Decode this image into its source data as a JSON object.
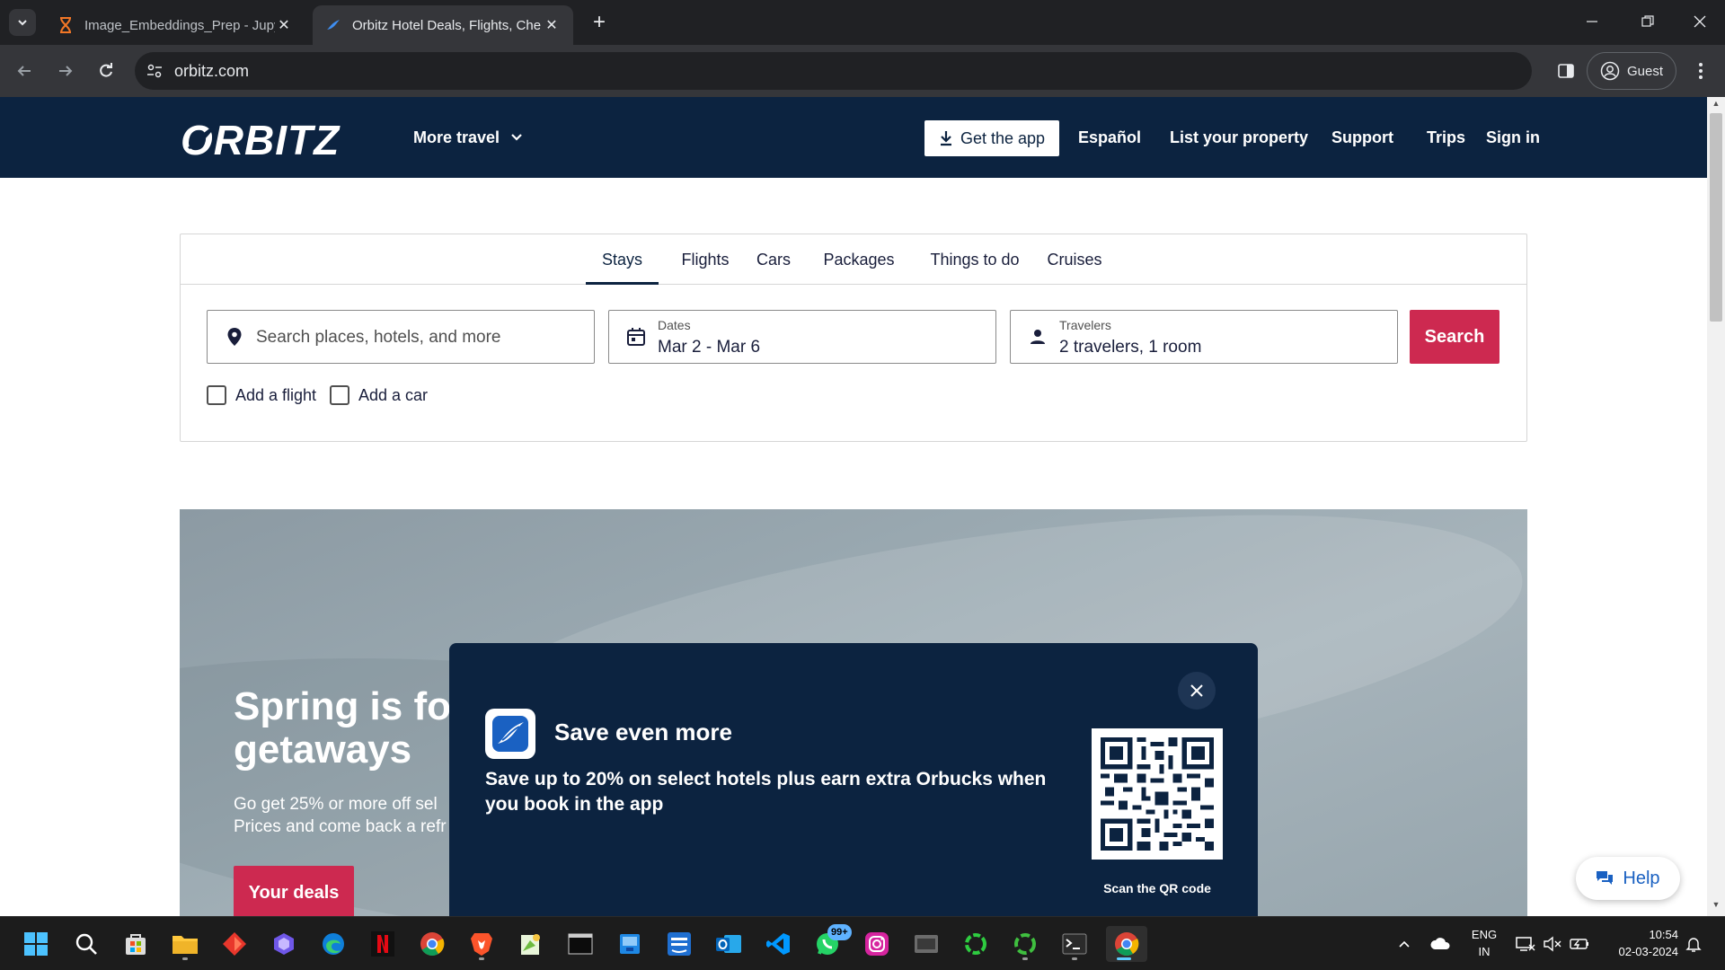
{
  "browser": {
    "tabs": [
      {
        "title": "Image_Embeddings_Prep - Jupy",
        "active": false
      },
      {
        "title": "Orbitz Hotel Deals, Flights, Che",
        "active": true
      }
    ],
    "address": "orbitz.com",
    "profile_label": "Guest"
  },
  "header": {
    "logo_text": "ORBITZ",
    "more_travel": "More travel",
    "get_app": "Get the app",
    "nav": [
      "Español",
      "List your property",
      "Support",
      "Trips",
      "Sign in"
    ]
  },
  "search": {
    "tabs": [
      "Stays",
      "Flights",
      "Cars",
      "Packages",
      "Things to do",
      "Cruises"
    ],
    "active_tab": "Stays",
    "destination_placeholder": "Search places, hotels, and more",
    "dates_label": "Dates",
    "dates_value": "Mar 2 - Mar 6",
    "travelers_label": "Travelers",
    "travelers_value": "2 travelers, 1 room",
    "search_button": "Search",
    "add_flight": "Add a flight",
    "add_car": "Add a car"
  },
  "hero": {
    "title_line1": "Spring is fo",
    "title_line2": "getaways",
    "subtitle_line1": "Go get 25% or more off sel",
    "subtitle_line2": "Prices and come back a refr",
    "deals_button": "Your deals"
  },
  "promo": {
    "title": "Save even more",
    "text": "Save up to 20% on select hotels plus earn extra Orbucks when you book in the app",
    "qr_caption": "Scan the QR code"
  },
  "help_button": "Help",
  "taskbar": {
    "apps": [
      "windows-start",
      "search",
      "store",
      "file-explorer",
      "app-red-diamond",
      "copilot",
      "edge",
      "netflix",
      "chrome",
      "brave",
      "notepad-plus",
      "terminal-dark",
      "app-blue",
      "prime-video",
      "outlook",
      "vscode",
      "whatsapp",
      "instagram",
      "app-gray",
      "app-green-ring",
      "app-green-ring-2",
      "terminal",
      "chrome-active"
    ],
    "whatsapp_badge": "99+",
    "language_line1": "ENG",
    "language_line2": "IN",
    "time": "10:54",
    "date": "02-03-2024"
  },
  "colors": {
    "brand_navy": "#0c2340",
    "brand_pink": "#cd2950",
    "help_blue": "#1a61c2"
  }
}
